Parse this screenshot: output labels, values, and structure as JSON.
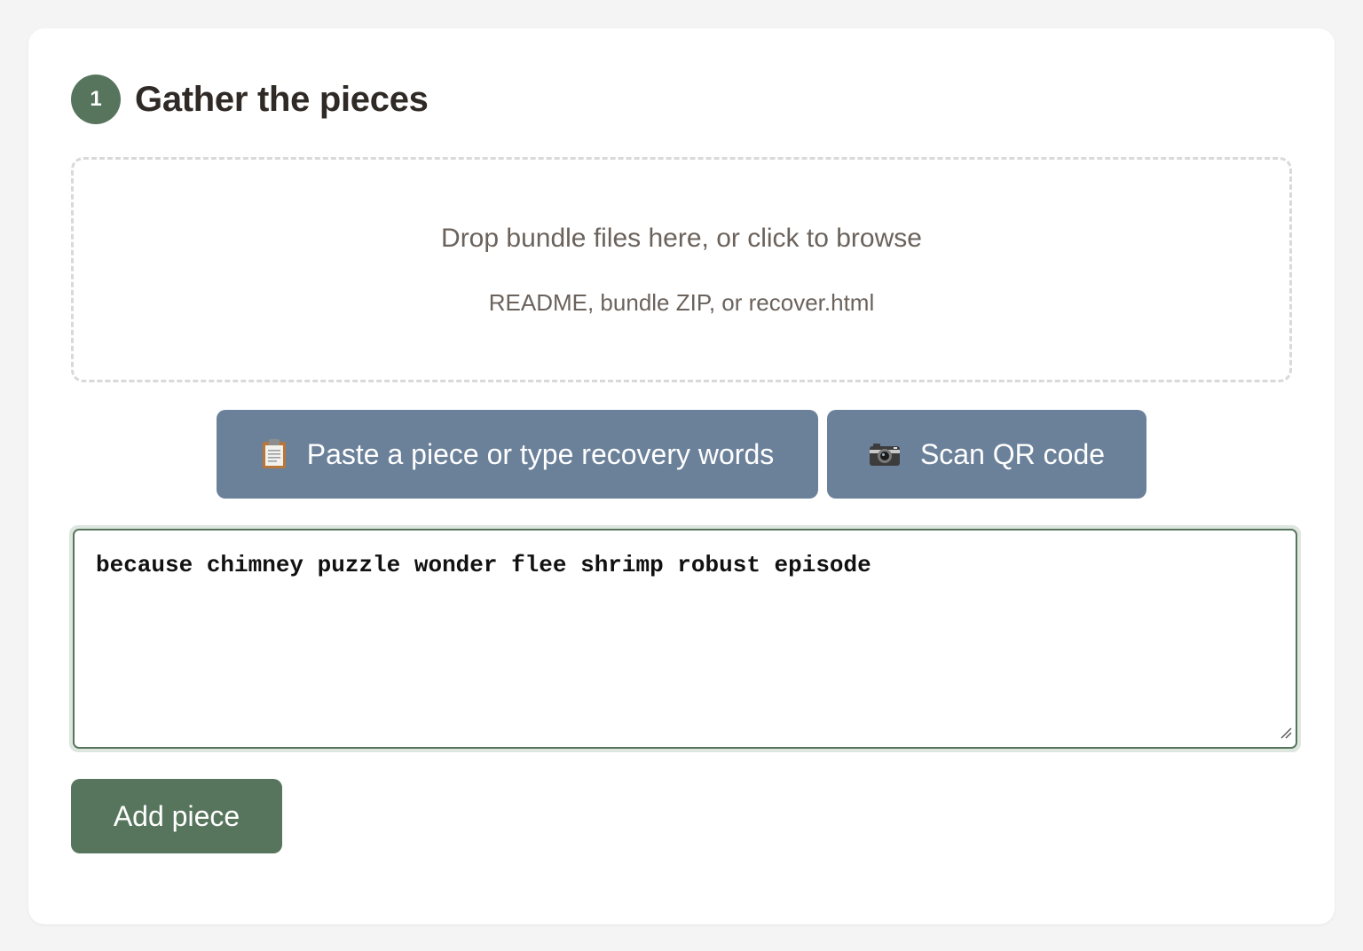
{
  "step": {
    "number": "1",
    "title": "Gather the pieces"
  },
  "dropzone": {
    "main_text": "Drop bundle files here, or click to browse",
    "sub_text": "README, bundle ZIP, or recover.html"
  },
  "actions": {
    "paste_label": "Paste a piece or type recovery words",
    "paste_icon": "clipboard-icon",
    "scan_label": "Scan QR code",
    "scan_icon": "camera-icon"
  },
  "piece_input": {
    "value": "because chimney puzzle wonder flee shrimp robust episode"
  },
  "add_button": {
    "label": "Add piece"
  },
  "colors": {
    "accent_green": "#56755c",
    "action_blue": "#6b819a",
    "background": "#f4f4f4"
  }
}
